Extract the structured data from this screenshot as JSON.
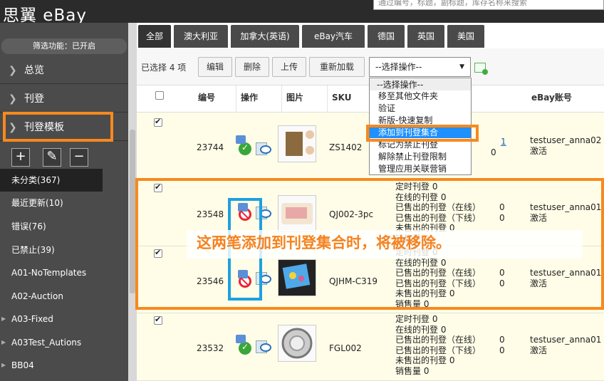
{
  "app": {
    "logo_text": "思翼 eBay",
    "search_placeholder": "通过编号，标题，副标题，库存名称来搜索"
  },
  "sidebar": {
    "filter_status": "筛选功能：已开启",
    "nav": [
      {
        "label": "总览"
      },
      {
        "label": "刊登"
      },
      {
        "label": "刊登模板"
      }
    ],
    "tool_icons": [
      "plus-icon",
      "pencil-icon",
      "minus-icon"
    ],
    "categories": [
      {
        "label": "未分类(367)",
        "active": true
      },
      {
        "label": "最近更新(10)"
      },
      {
        "label": "错误(76)"
      },
      {
        "label": "已禁止(39)"
      },
      {
        "label": "A01-NoTemplates"
      },
      {
        "label": "A02-Auction"
      },
      {
        "label": "A03-Fixed"
      },
      {
        "label": "A03Test_Autions"
      },
      {
        "label": "BB04"
      }
    ]
  },
  "tabs": [
    "全部",
    "澳大利亚",
    "加拿大(英语)",
    "eBay汽车",
    "德国",
    "英国",
    "美国"
  ],
  "toolbar": {
    "selected_count": "已选择 4 项",
    "buttons": [
      "编辑",
      "删除",
      "上传",
      "重新加载"
    ],
    "operation_select": "--选择操作--"
  },
  "dropdown": {
    "options": [
      "--选择操作--",
      "移至其他文件夹",
      "验证",
      "新版-快速复制",
      "添加到刊登集合",
      "标记为禁止刊登",
      "解除禁止刊登限制",
      "管理应用关联营销"
    ],
    "selected_index": 4
  },
  "table": {
    "headers": [
      "编号",
      "操作",
      "图片",
      "SKU",
      "eBay账号"
    ],
    "stat_labels": [
      "定时刊登",
      "在线的刊登",
      "已售出的刊登（在线）",
      "已售出的刊登（下线）",
      "未售出的刊登",
      "销售量"
    ],
    "rows": [
      {
        "id": "23744",
        "sku": "ZS1402",
        "account": "testuser_anna02",
        "status": "激活",
        "checked": true,
        "action": "ok",
        "stats": [
          "",
          "",
          "",
          "",
          "",
          ""
        ],
        "extra": [
          "1",
          "0"
        ]
      },
      {
        "id": "23548",
        "sku": "QJ002-3pc",
        "account": "testuser_anna01",
        "status": "激活",
        "checked": true,
        "action": "ban",
        "stats": [
          "0",
          "0",
          "0",
          "0",
          "0",
          "0"
        ]
      },
      {
        "id": "23546",
        "sku": "QJHM-C319",
        "account": "testuser_anna01",
        "status": "激活",
        "checked": true,
        "action": "ban",
        "stats": [
          "0",
          "0",
          "0",
          "0",
          "0",
          "0"
        ]
      },
      {
        "id": "23532",
        "sku": "FGL002",
        "account": "testuser_anna01",
        "status": "激活",
        "checked": true,
        "action": "ok",
        "stats": [
          "0",
          "0",
          "0",
          "0",
          "0",
          "0"
        ]
      }
    ]
  },
  "annotation": {
    "text": "这两笔添加到刊登集合时，将被移除。",
    "color": "#f58220"
  },
  "colors": {
    "highlight_orange": "#f7891e",
    "highlight_blue": "#1ea0e0",
    "dropdown_selected": "#1e90ff",
    "row_bg": "#fffde8"
  }
}
